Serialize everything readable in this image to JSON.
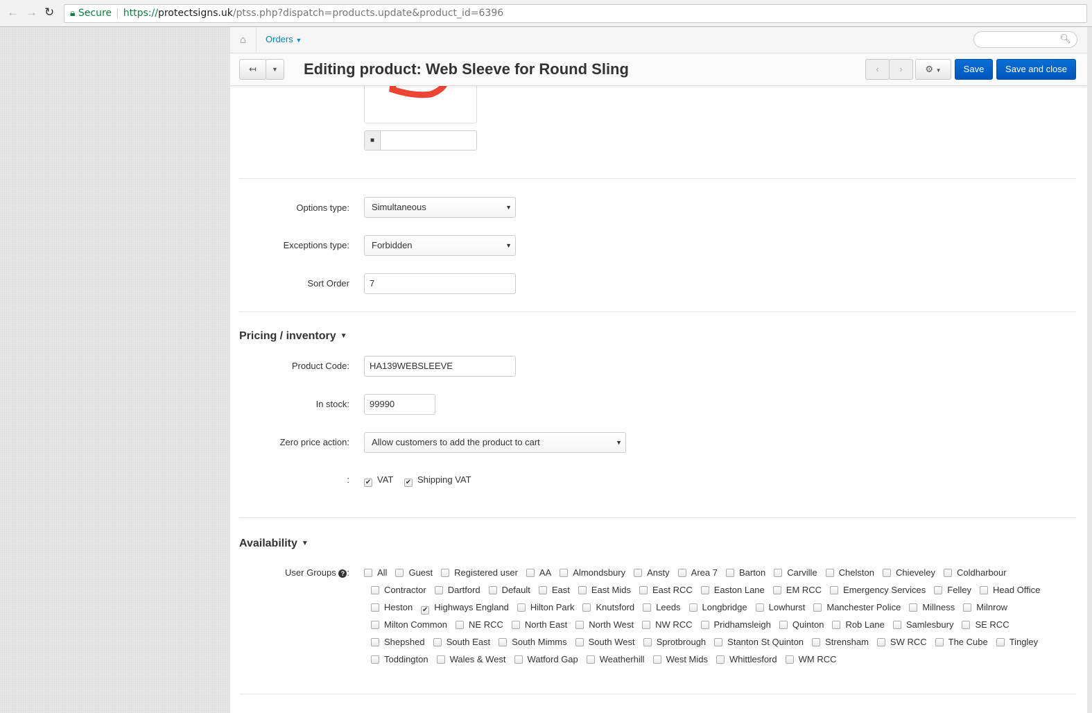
{
  "browser": {
    "secure": "Secure",
    "url_scheme": "https://",
    "url_host": "protectsigns.uk",
    "url_path": "/ptss.php?dispatch=products.update&product_id=6396"
  },
  "nav": {
    "orders": "Orders"
  },
  "toolbar": {
    "title": "Editing product: Web Sleeve for Round Sling",
    "save": "Save",
    "save_close": "Save and close"
  },
  "form": {
    "options_type_label": "Options type:",
    "options_type": "Simultaneous",
    "exceptions_type_label": "Exceptions type:",
    "exceptions_type": "Forbidden",
    "sort_order_label": "Sort Order",
    "sort_order": "7"
  },
  "pricing": {
    "heading": "Pricing / inventory",
    "product_code_label": "Product Code:",
    "product_code": "HA139WEBSLEEVE",
    "in_stock_label": "In stock:",
    "in_stock": "99990",
    "zero_price_label": "Zero price action:",
    "zero_price": "Allow customers to add the product to cart",
    "tax_label": ":",
    "taxes": [
      {
        "label": "VAT",
        "checked": true
      },
      {
        "label": "Shipping VAT",
        "checked": true
      }
    ]
  },
  "availability": {
    "heading": "Availability",
    "user_groups_label": "User Groups",
    "rows": [
      [
        {
          "label": "All"
        },
        {
          "label": "Guest"
        },
        {
          "label": "Registered user"
        },
        {
          "label": "AA"
        },
        {
          "label": "Almondsbury"
        },
        {
          "label": "Ansty"
        },
        {
          "label": "Area 7"
        },
        {
          "label": "Barton"
        },
        {
          "label": "Carville"
        },
        {
          "label": "Chelston"
        },
        {
          "label": "Chieveley"
        },
        {
          "label": "Coldharbour"
        }
      ],
      [
        {
          "label": "Contractor"
        },
        {
          "label": "Dartford"
        },
        {
          "label": "Default"
        },
        {
          "label": "East"
        },
        {
          "label": "East Mids"
        },
        {
          "label": "East RCC"
        },
        {
          "label": "Easton Lane"
        },
        {
          "label": "EM RCC"
        },
        {
          "label": "Emergency Services"
        },
        {
          "label": "Felley"
        },
        {
          "label": "Head Office"
        }
      ],
      [
        {
          "label": "Heston"
        },
        {
          "label": "Highways England",
          "checked": true
        },
        {
          "label": "Hilton Park"
        },
        {
          "label": "Knutsford"
        },
        {
          "label": "Leeds"
        },
        {
          "label": "Longbridge"
        },
        {
          "label": "Lowhurst"
        },
        {
          "label": "Manchester Police"
        },
        {
          "label": "Millness"
        },
        {
          "label": "Milnrow"
        }
      ],
      [
        {
          "label": "Milton Common"
        },
        {
          "label": "NE RCC"
        },
        {
          "label": "North East"
        },
        {
          "label": "North West"
        },
        {
          "label": "NW RCC"
        },
        {
          "label": "Pridhamsleigh"
        },
        {
          "label": "Quinton"
        },
        {
          "label": "Rob Lane"
        },
        {
          "label": "Samlesbury"
        },
        {
          "label": "SE RCC"
        }
      ],
      [
        {
          "label": "Shepshed"
        },
        {
          "label": "South East"
        },
        {
          "label": "South Mimms"
        },
        {
          "label": "South West"
        },
        {
          "label": "Sprotbrough"
        },
        {
          "label": "Stanton St Quinton"
        },
        {
          "label": "Strensham"
        },
        {
          "label": "SW RCC"
        },
        {
          "label": "The Cube"
        },
        {
          "label": "Tingley"
        }
      ],
      [
        {
          "label": "Toddington"
        },
        {
          "label": "Wales & West"
        },
        {
          "label": "Watford Gap"
        },
        {
          "label": "Weatherhill"
        },
        {
          "label": "West Mids"
        },
        {
          "label": "Whittlesford"
        },
        {
          "label": "WM RCC"
        }
      ]
    ]
  }
}
